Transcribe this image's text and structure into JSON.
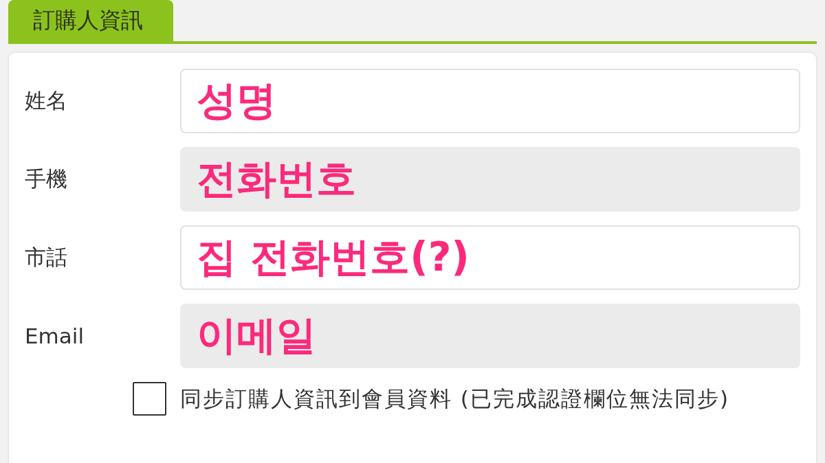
{
  "tabs": [
    {
      "label": "訂購人資訊",
      "selected": true
    }
  ],
  "form": {
    "fields": [
      {
        "label": "姓名",
        "annotation": "성명",
        "disabled": false
      },
      {
        "label": "手機",
        "annotation": "전화번호",
        "disabled": true
      },
      {
        "label": "市話",
        "annotation": "집 전화번호(?)",
        "disabled": false
      },
      {
        "label": "Email",
        "annotation": "이메일",
        "disabled": true
      }
    ]
  },
  "sync_checkbox": {
    "label": "同步訂購人資訊到會員資料 (已完成認證欄位無法同步)",
    "checked": false
  }
}
